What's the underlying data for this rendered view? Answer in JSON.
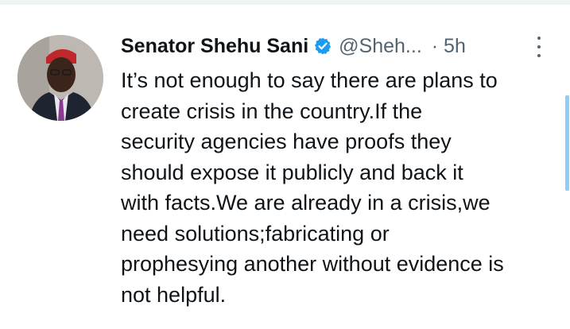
{
  "tweet": {
    "author_name": "Senator Shehu Sani",
    "handle": "@Sheh...",
    "time": "· 5h",
    "verified": true,
    "text": "It’s not enough to say there are plans to\ncreate crisis in the country.If the\nsecurity agencies have proofs they\nshould expose it publicly and back it\nwith facts.We are already in a crisis,we\nneed solutions;fabricating or\nprophesying another without evidence is\nnot helpful."
  },
  "icons": {
    "verified": "verified-badge-icon",
    "more": "more-options-icon"
  },
  "colors": {
    "verified": "#1d9bf0",
    "secondary_text": "#536471",
    "primary_text": "#0f1419"
  }
}
